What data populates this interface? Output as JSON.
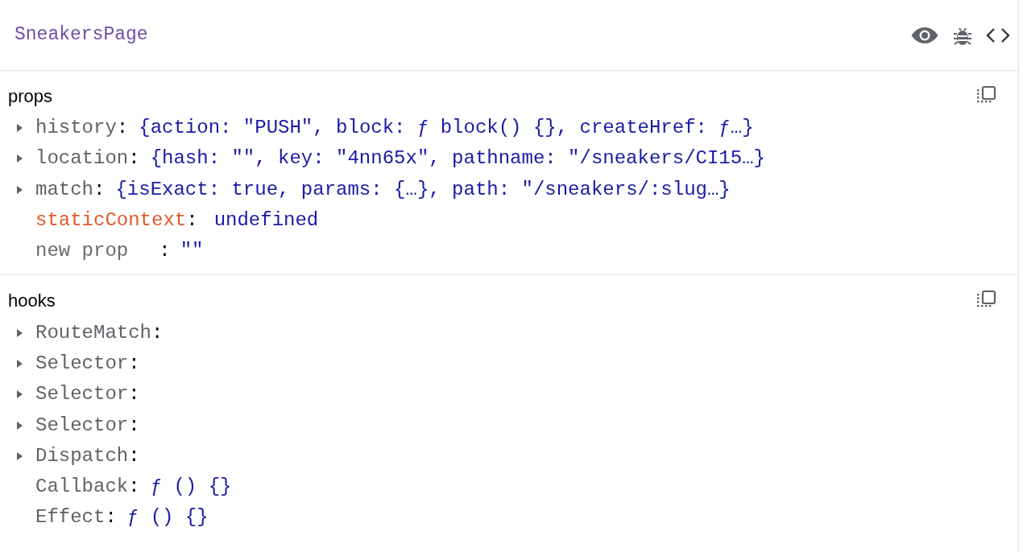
{
  "component": {
    "title": "SneakersPage"
  },
  "sections": [
    {
      "title": "props",
      "rows": [
        {
          "name": "history",
          "value": "{action: \"PUSH\", block: ƒ block() {}, createHref: ƒ…}",
          "expandable": true,
          "kind": "prop",
          "separator": ":"
        },
        {
          "name": "location",
          "value": "{hash: \"\", key: \"4nn65x\", pathname: \"/sneakers/CI15…}",
          "expandable": true,
          "kind": "prop",
          "separator": ":"
        },
        {
          "name": "match",
          "value": "{isExact: true, params: {…}, path: \"/sneakers/:slug…}",
          "expandable": true,
          "kind": "prop",
          "separator": ":"
        },
        {
          "name": "staticContext",
          "value": "undefined",
          "expandable": false,
          "kind": "changed",
          "separator": ":"
        },
        {
          "name": "new prop",
          "value": "\"\"",
          "expandable": false,
          "kind": "new",
          "separator": ":"
        }
      ]
    },
    {
      "title": "hooks",
      "rows": [
        {
          "name": "RouteMatch",
          "expandable": true,
          "kind": "prop",
          "separator": ":"
        },
        {
          "name": "Selector",
          "expandable": true,
          "kind": "prop",
          "separator": ":"
        },
        {
          "name": "Selector",
          "expandable": true,
          "kind": "prop",
          "separator": ":"
        },
        {
          "name": "Selector",
          "expandable": true,
          "kind": "prop",
          "separator": ":"
        },
        {
          "name": "Dispatch",
          "expandable": true,
          "kind": "prop",
          "separator": ":"
        },
        {
          "name": "Callback",
          "value": "ƒ () {}",
          "expandable": false,
          "kind": "prop",
          "separator": ":"
        },
        {
          "name": "Effect",
          "value": "ƒ () {}",
          "expandable": false,
          "kind": "prop",
          "separator": ":"
        }
      ]
    }
  ]
}
